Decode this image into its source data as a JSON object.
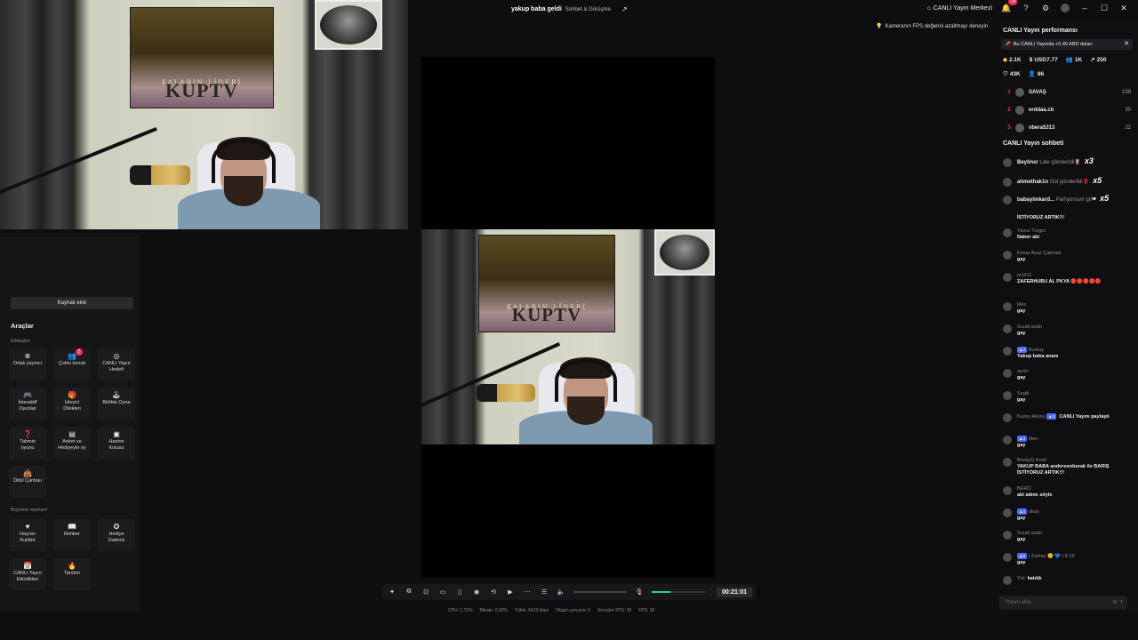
{
  "topbar": {
    "stream_title": "yakup baba geldi",
    "stream_sub": "Sohbet & Görüşme",
    "live_center": "CANLI Yayın Merkezi",
    "notif_count": "14"
  },
  "fps_tip": "Kameranın FPS değerini azaltmayı deneyin",
  "left_panel": {
    "add_source": "Kaynak ekle",
    "tools_title": "Araçlar",
    "section_interaction": "Etkileşim",
    "section_growth": "Büyüme merkezi",
    "tools": [
      {
        "label1": "Ortak yayıncı",
        "label2": ""
      },
      {
        "label1": "Çoklu konuk",
        "label2": ""
      },
      {
        "label1": "CANLI Yayın",
        "label2": "Hedefi"
      },
      {
        "label1": "İnteraktif",
        "label2": "Oyunlar"
      },
      {
        "label1": "İzleyici",
        "label2": "Dilekleri"
      },
      {
        "label1": "Birlikte Oyna",
        "label2": ""
      },
      {
        "label1": "Tahmin",
        "label2": "oyunu"
      },
      {
        "label1": "Anket ve",
        "label2": "Hediyeyle oy"
      },
      {
        "label1": "Hazine",
        "label2": "Kutusu"
      },
      {
        "label1": "Ödül Çantası",
        "label2": ""
      }
    ],
    "multi_guest_badge": "2",
    "growth_tools": [
      {
        "label1": "Hayran",
        "label2": "Kulübü"
      },
      {
        "label1": "Rehber",
        "label2": ""
      },
      {
        "label1": "Hediye",
        "label2": "Galerisi"
      },
      {
        "label1": "CANLI Yayın",
        "label2": "Etkinlikleri"
      },
      {
        "label1": "Tanıtım",
        "label2": ""
      }
    ]
  },
  "poster": {
    "top_text": "KALARIN LİDERİ",
    "main_text": "KUPTV"
  },
  "controls": {
    "timer": "00:21:01",
    "mic_level": 0.35
  },
  "stats": {
    "cpu": "CPU: 1.72%",
    "bitrate": "Bitrate: 0.93%",
    "upload": "Yükle: 5413 kbps",
    "dropped": "Düşen çerçeve: 0",
    "encoder_fps": "Encoder FPS: 30",
    "fps": "FPS: 30"
  },
  "right_panel": {
    "perf_title": "CANLI Yayın performansı",
    "earn_banner": "Bu CANLI Yayında +0.40 ABD doları",
    "stats": {
      "diamonds": "2.1K",
      "usd": "USD7.77",
      "viewers": "1K",
      "shares": "250",
      "likes": "43K",
      "new_followers": "86"
    },
    "ranking": [
      {
        "rank": "1",
        "name": "SAVAŞ",
        "score": "139"
      },
      {
        "rank": "2",
        "name": "erddaa.cb",
        "score": "30"
      },
      {
        "rank": "3",
        "name": "vbera5313",
        "score": "22"
      }
    ],
    "chat_title": "CANLI Yayın sohbeti",
    "gifts": [
      {
        "user": "Beylinsr",
        "text": "Lale gönderildi",
        "mult": "x3"
      },
      {
        "user": "ahmethak1n",
        "text": "Gül gönderildi",
        "mult": "x5"
      },
      {
        "user": "babayimkard...",
        "text": "Parlıyorsun! gö",
        "mult": "x5"
      }
    ],
    "chat": [
      {
        "user": "",
        "msg": "İSTİYORUZ ARTIK!!!"
      },
      {
        "user": "Yavuz Turgut",
        "msg": "Naber abi"
      },
      {
        "user": "Ensar Ayaz Çakmak",
        "msg": "gay"
      },
      {
        "user": "m1911",
        "msg": "ZAFERHUBU AL PKYA 🔴🔴🔴🔴🔴"
      },
      {
        "user": "Mex",
        "msg": "gay"
      },
      {
        "user": "Suudi arabi",
        "msg": "gay"
      },
      {
        "user": "Burkay",
        "msg": "Yakup baba ananı"
      },
      {
        "user": "aydzi",
        "msg": "gay"
      },
      {
        "user": "Segili·",
        "msg": "gay"
      },
      {
        "user": "Kuzey Aksoy",
        "msg": "CANLI Yayını paylaştı"
      },
      {
        "user": "İlker·",
        "msg": "gay"
      },
      {
        "user": "BeckyG Kesit",
        "msg": "YAKUP BABA andersonburak ile BARIŞ İSTİYORUZ ARTIK!!!"
      },
      {
        "user": "BERO",
        "msg": "abi adımı söyle"
      },
      {
        "user": "okan",
        "msg": "gay"
      },
      {
        "user": "Suudi arabi",
        "msg": "gay"
      },
      {
        "user": "| Zaktay 😊 💙 | 8.1K",
        "msg": "gay"
      },
      {
        "user": "Yrd.",
        "msg": "katıldı"
      }
    ],
    "comment_placeholder": "Yorum ekle"
  }
}
